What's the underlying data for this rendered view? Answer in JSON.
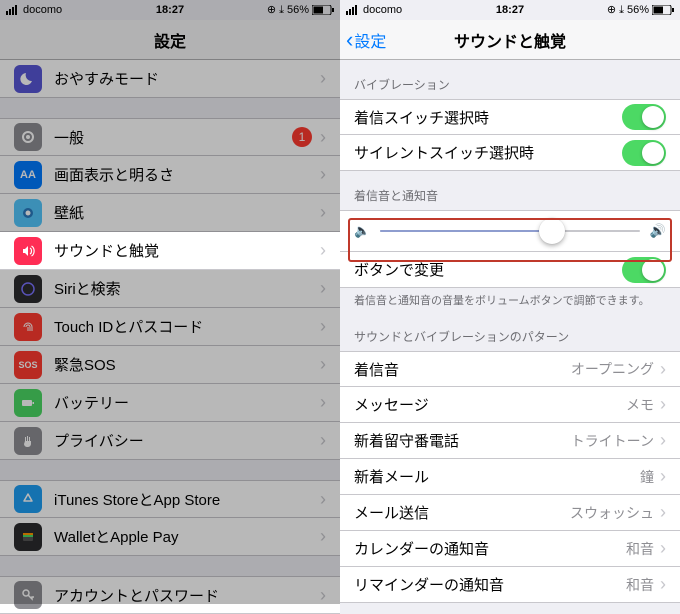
{
  "status": {
    "carrier": "docomo",
    "time": "18:27",
    "battery": "56%"
  },
  "left": {
    "title": "設定",
    "items": [
      {
        "key": "dnd",
        "label": "おやすみモード",
        "color": "#5856d6"
      },
      {
        "key": "general",
        "label": "一般",
        "color": "#8e8e93",
        "badge": "1"
      },
      {
        "key": "display",
        "label": "画面表示と明るさ",
        "color": "#007aff"
      },
      {
        "key": "wallpaper",
        "label": "壁紙",
        "color": "#54c7fc"
      },
      {
        "key": "sound",
        "label": "サウンドと触覚",
        "color": "#ff2d55"
      },
      {
        "key": "siri",
        "label": "Siriと検索",
        "color": "#2b2b2e"
      },
      {
        "key": "touchid",
        "label": "Touch IDとパスコード",
        "color": "#ff3b30"
      },
      {
        "key": "sos",
        "label": "緊急SOS",
        "color": "#ff3b30"
      },
      {
        "key": "battery",
        "label": "バッテリー",
        "color": "#4cd964"
      },
      {
        "key": "privacy",
        "label": "プライバシー",
        "color": "#8e8e93"
      },
      {
        "key": "itunes",
        "label": "iTunes StoreとApp Store",
        "color": "#1e9ef4"
      },
      {
        "key": "wallet",
        "label": "WalletとApple Pay",
        "color": "#2b2b2e"
      },
      {
        "key": "accounts",
        "label": "アカウントとパスワード",
        "color": "#8e8e93"
      }
    ]
  },
  "right": {
    "back": "設定",
    "title": "サウンドと触覚",
    "sections": {
      "vibration_header": "バイブレーション",
      "ring_switch": "着信スイッチ選択時",
      "silent_switch": "サイレントスイッチ選択時",
      "ringer_header": "着信音と通知音",
      "button_change": "ボタンで変更",
      "footer": "着信音と通知音の音量をボリュームボタンで調節できます。",
      "patterns_header": "サウンドとバイブレーションのパターン",
      "rows": [
        {
          "label": "着信音",
          "detail": "オープニング"
        },
        {
          "label": "メッセージ",
          "detail": "メモ"
        },
        {
          "label": "新着留守番電話",
          "detail": "トライトーン"
        },
        {
          "label": "新着メール",
          "detail": "鐘"
        },
        {
          "label": "メール送信",
          "detail": "スウォッシュ"
        },
        {
          "label": "カレンダーの通知音",
          "detail": "和音"
        },
        {
          "label": "リマインダーの通知音",
          "detail": "和音"
        }
      ]
    }
  }
}
